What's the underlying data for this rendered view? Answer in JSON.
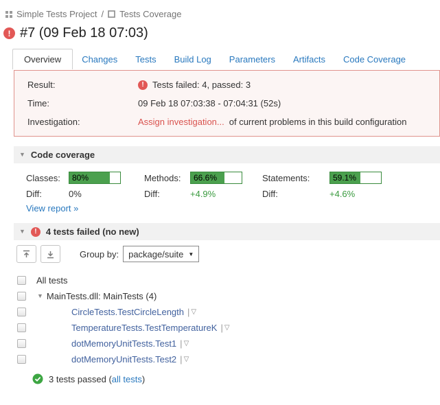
{
  "breadcrumb": {
    "project": "Simple Tests Project",
    "separator": "/",
    "config": "Tests Coverage"
  },
  "build": {
    "title": "#7 (09 Feb 18 07:03)",
    "error_glyph": "!"
  },
  "tabs": [
    {
      "label": "Overview",
      "active": true
    },
    {
      "label": "Changes",
      "active": false
    },
    {
      "label": "Tests",
      "active": false
    },
    {
      "label": "Build Log",
      "active": false
    },
    {
      "label": "Parameters",
      "active": false
    },
    {
      "label": "Artifacts",
      "active": false
    },
    {
      "label": "Code Coverage",
      "active": false
    }
  ],
  "result_box": {
    "result_label": "Result:",
    "result_value": "Tests failed: 4, passed: 3",
    "time_label": "Time:",
    "time_value": "09 Feb 18 07:03:38 - 07:04:31 (52s)",
    "investigation_label": "Investigation:",
    "investigation_link": "Assign investigation...",
    "investigation_rest": "of current problems in this build configuration"
  },
  "coverage": {
    "header": "Code coverage",
    "metrics": [
      {
        "label": "Classes:",
        "value": "80%",
        "percent": 80,
        "diff_label": "Diff:",
        "diff": "0%"
      },
      {
        "label": "Methods:",
        "value": "66.6%",
        "percent": 66.6,
        "diff_label": "Diff:",
        "diff": "+4.9%"
      },
      {
        "label": "Statements:",
        "value": "59.1%",
        "percent": 59.1,
        "diff_label": "Diff:",
        "diff": "+4.6%"
      }
    ],
    "view_report": "View report »"
  },
  "tests_section": {
    "header": "4 tests failed (no new)",
    "group_by_label": "Group by:",
    "group_by_value": "package/suite",
    "tree": {
      "all_tests_label": "All tests",
      "suite_label": "MainTests.dll: MainTests (4)",
      "failed_tests": [
        "CircleTests.TestCircleLength",
        "TemperatureTests.TestTemperatureK",
        "dotMemoryUnitTests.Test1",
        "dotMemoryUnitTests.Test2"
      ],
      "menu_separator": "|"
    },
    "passed_prefix": "3 tests passed (",
    "passed_link": "all tests",
    "passed_suffix": ")"
  },
  "icons": {
    "collapse_triangle": "▼",
    "test_actions_dropdown": "▽",
    "select_arrow": "▼"
  },
  "colors": {
    "error_red": "#e25856",
    "error_box_border": "#e0938d",
    "error_box_bg": "#fcf5f4",
    "investigation_link_red": "#d9534f",
    "coverage_green_fill": "#4ba04e",
    "coverage_green_border": "#388a3c",
    "diff_green": "#3a9a3f",
    "link_blue": "#2878be",
    "test_link_blue": "#41619e",
    "passed_green": "#3da643",
    "section_header_bg": "#f1f1f1",
    "breadcrumb_gray": "#747474"
  }
}
